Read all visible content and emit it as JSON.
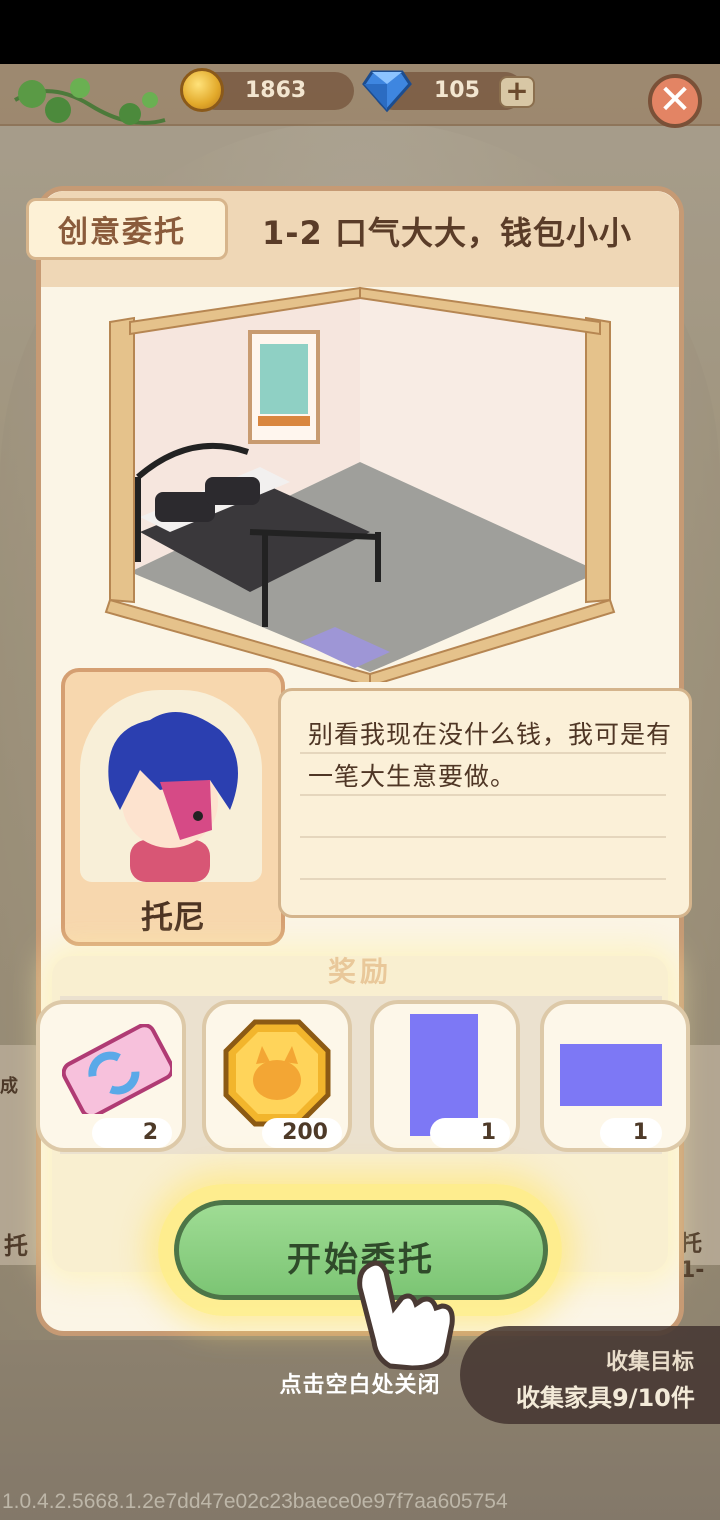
{
  "hud": {
    "coins": "1863",
    "gems": "105",
    "add_label": "+",
    "close_label": "✕"
  },
  "commission": {
    "tag": "创意委托",
    "title": "1-2 口气大大，钱包小小"
  },
  "npc": {
    "name": "托尼",
    "dialogue": "别看我现在没什么钱，我可是有一笔大生意要做。"
  },
  "rewards": {
    "title": "奖励",
    "items": [
      {
        "icon": "ticket-icon",
        "count": "2"
      },
      {
        "icon": "coin-icon",
        "count": "200"
      },
      {
        "icon": "placeholder-item-icon",
        "count": "1"
      },
      {
        "icon": "placeholder-item-icon",
        "count": "1"
      }
    ]
  },
  "start_button": "开始委托",
  "close_hint": "点击空白处关闭",
  "side": {
    "left_label_top": "成",
    "left_label": "托",
    "right_label": "托1-"
  },
  "goal": {
    "title": "收集目标",
    "progress": "收集家具9/10件"
  },
  "version": "1.0.4.2.5668.1.2e7dd47e02c23baece0e97f7aa605754"
}
